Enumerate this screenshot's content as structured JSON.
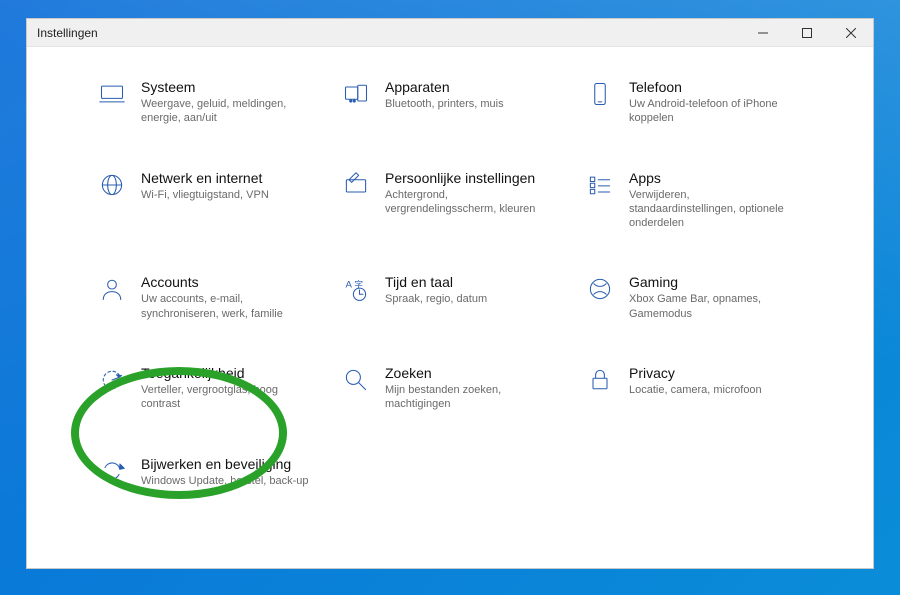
{
  "window": {
    "title": "Instellingen"
  },
  "tiles": [
    {
      "id": "system",
      "title": "Systeem",
      "sub": "Weergave, geluid, meldingen, energie, aan/uit"
    },
    {
      "id": "devices",
      "title": "Apparaten",
      "sub": "Bluetooth, printers, muis"
    },
    {
      "id": "phone",
      "title": "Telefoon",
      "sub": "Uw Android-telefoon of iPhone koppelen"
    },
    {
      "id": "network",
      "title": "Netwerk en internet",
      "sub": "Wi-Fi, vliegtuigstand, VPN"
    },
    {
      "id": "personal",
      "title": "Persoonlijke instellingen",
      "sub": "Achtergrond, vergrendelingsscherm, kleuren"
    },
    {
      "id": "apps",
      "title": "Apps",
      "sub": "Verwijderen, standaardinstellingen, optionele onderdelen"
    },
    {
      "id": "accounts",
      "title": "Accounts",
      "sub": "Uw accounts, e-mail, synchroniseren, werk, familie"
    },
    {
      "id": "time",
      "title": "Tijd en taal",
      "sub": "Spraak, regio, datum"
    },
    {
      "id": "gaming",
      "title": "Gaming",
      "sub": "Xbox Game Bar, opnames, Gamemodus"
    },
    {
      "id": "ease",
      "title": "Toegankelijkheid",
      "sub": "Verteller, vergrootglas, hoog contrast"
    },
    {
      "id": "search",
      "title": "Zoeken",
      "sub": "Mijn bestanden zoeken, machtigingen"
    },
    {
      "id": "privacy",
      "title": "Privacy",
      "sub": "Locatie, camera, microfoon"
    },
    {
      "id": "update",
      "title": "Bijwerken en beveiliging",
      "sub": "Windows Update, herstel, back-up"
    }
  ],
  "annotation": {
    "highlighted_tile_id": "ease"
  }
}
